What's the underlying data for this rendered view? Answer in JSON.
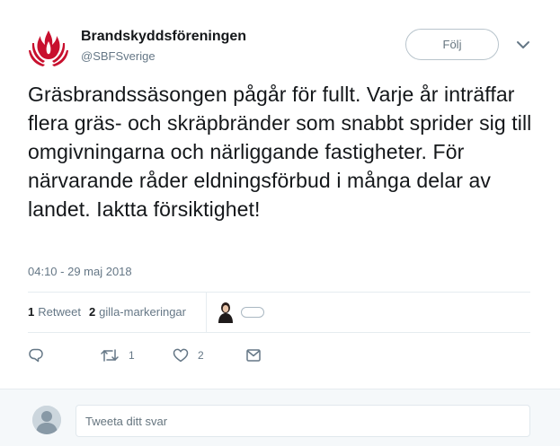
{
  "account": {
    "name": "Brandskyddsföreningen",
    "handle": "@SBFSverige",
    "brand_color": "#c8102e"
  },
  "header": {
    "follow_label": "Följ"
  },
  "tweet": {
    "text": "Gräsbrandssäsongen pågår för fullt. Varje år inträffar flera gräs- och skräpbränder som snabbt sprider sig till omgivningarna och närliggande fastigheter. För närvarande råder eldningsförbud i många delar av landet. Iaktta försiktighet!",
    "timestamp": "04:10 - 29 maj 2018"
  },
  "stats": {
    "retweets_count": "1",
    "retweets_label": "Retweet",
    "likes_count": "2",
    "likes_label": "gilla-markeringar"
  },
  "actions": {
    "reply_icon": "reply-icon",
    "retweet_icon": "retweet-icon",
    "retweet_count": "1",
    "like_icon": "heart-icon",
    "like_count": "2",
    "dm_icon": "envelope-icon"
  },
  "reply": {
    "placeholder": "Tweeta ditt svar"
  }
}
